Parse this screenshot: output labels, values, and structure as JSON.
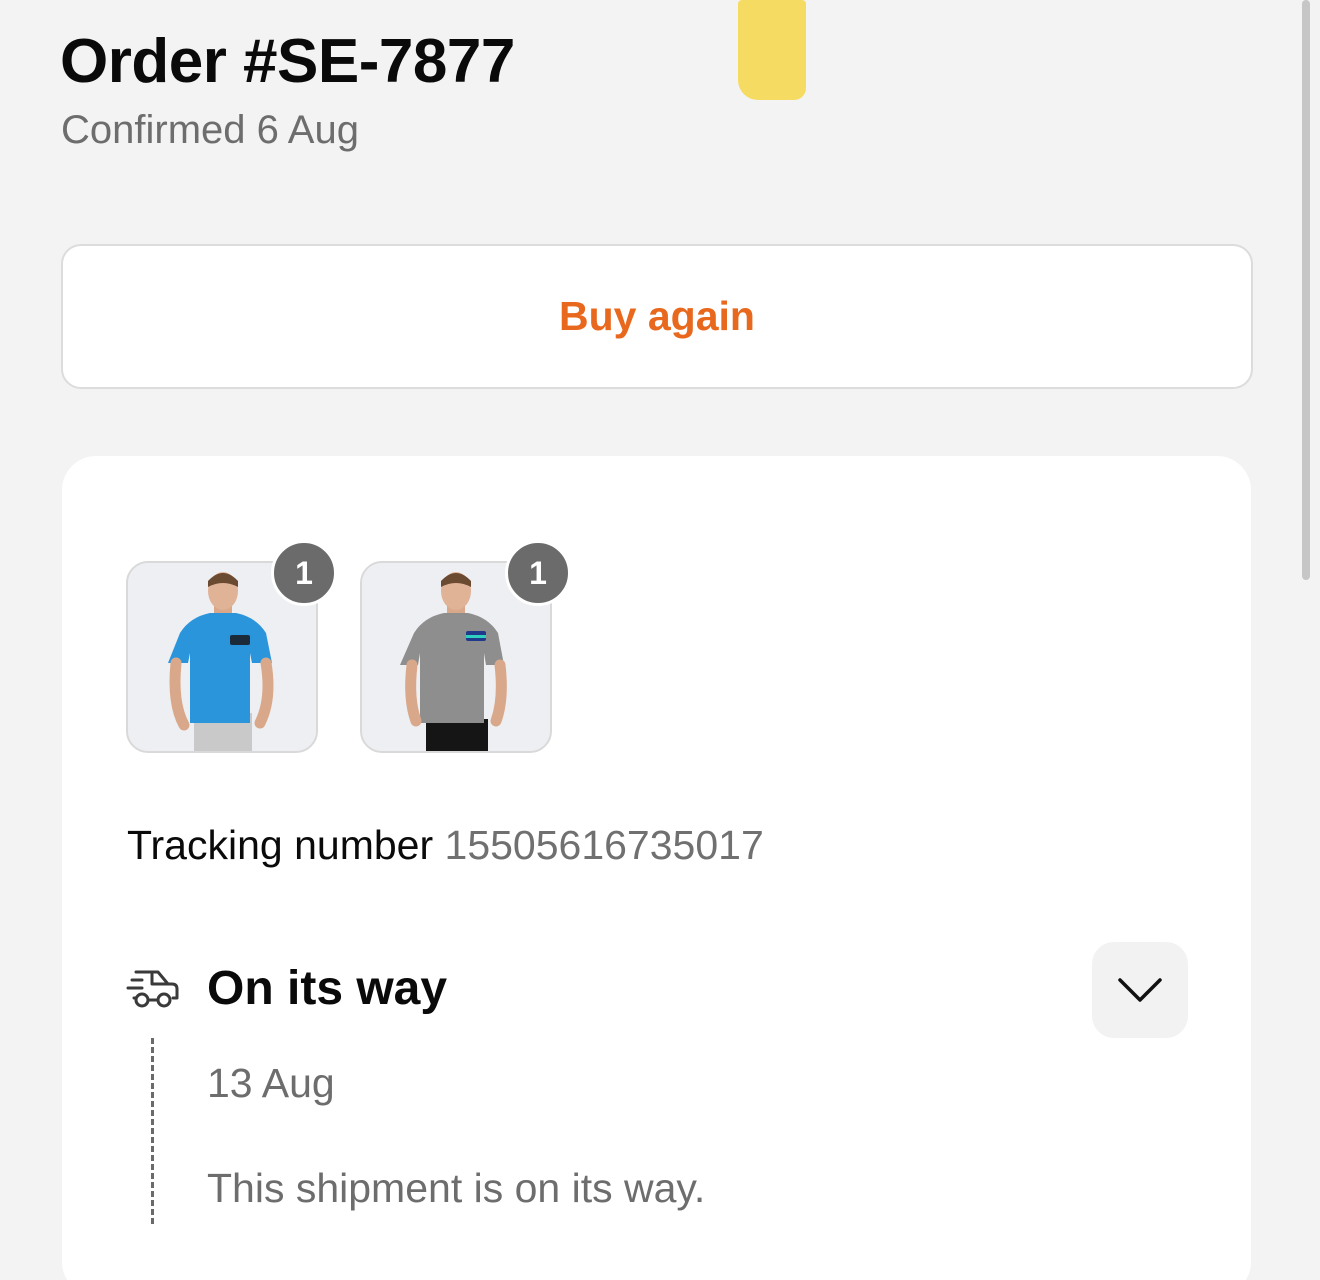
{
  "header": {
    "title": "Order #SE-7877",
    "subtitle": "Confirmed 6 Aug"
  },
  "actions": {
    "buy_again_label": "Buy again",
    "accent_color": "#e8691e"
  },
  "order_items": [
    {
      "name": "Blue t-shirt",
      "quantity": "1",
      "shirt_color": "#2b95dc"
    },
    {
      "name": "Grey t-shirt",
      "quantity": "1",
      "shirt_color": "#8e8e8e"
    }
  ],
  "tracking": {
    "label": "Tracking number",
    "number": "15505616735017"
  },
  "shipment": {
    "icon": "delivery-truck-icon",
    "status": "On its way",
    "date": "13 Aug",
    "description": "This shipment is on its way.",
    "expand_icon": "chevron-down-icon"
  }
}
